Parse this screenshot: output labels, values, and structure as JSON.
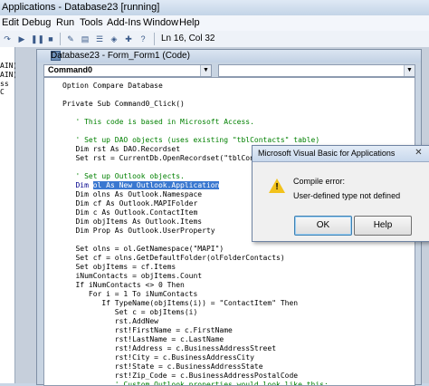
{
  "window": {
    "title": "Applications - Database23 [running]"
  },
  "menu": [
    "Edit",
    "Debug",
    "Run",
    "Tools",
    "Add-Ins",
    "Window",
    "Help"
  ],
  "toolbar": {
    "position": "Ln 16, Col 32"
  },
  "left_pane": [
    "AIN)",
    "AIN)",
    "ss C"
  ],
  "code_window": {
    "title": "Database23 - Form_Form1 (Code)",
    "object_combo": "Command0",
    "proc_combo": "",
    "lines": [
      "Option Compare Database",
      "",
      "Private Sub Command0_Click()",
      "",
      "   ' This code is based in Microsoft Access.",
      "",
      "   ' Set up DAO objects (uses existing \"tblContacts\" table)",
      "   Dim rst As DAO.Recordset",
      "   Set rst = CurrentDb.OpenRecordset(\"tblContacts\")",
      "",
      "   ' Set up Outlook objects.",
      "   Dim ol As New Outlook.Application",
      "   Dim olns As Outlook.Namespace",
      "   Dim cf As Outlook.MAPIFolder",
      "   Dim c As Outlook.ContactItem",
      "   Dim objItems As Outlook.Items",
      "   Dim Prop As Outlook.UserProperty",
      "",
      "   Set olns = ol.GetNamespace(\"MAPI\")",
      "   Set cf = olns.GetDefaultFolder(olFolderContacts)",
      "   Set objItems = cf.Items",
      "   iNumContacts = objItems.Count",
      "   If iNumContacts <> 0 Then",
      "      For i = 1 To iNumContacts",
      "         If TypeName(objItems(i)) = \"ContactItem\" Then",
      "            Set c = objItems(i)",
      "            rst.AddNew",
      "            rst!FirstName = c.FirstName",
      "            rst!LastName = c.LastName",
      "            rst!Address = c.BusinessAddressStreet",
      "            rst!City = c.BusinessAddressCity",
      "            rst!State = c.BusinessAddressState",
      "            rst!Zip_Code = c.BusinessAddressPostalCode",
      "            ' Custom Outlook properties would look like this:"
    ],
    "highlight": {
      "line": 11,
      "prefix": "   Dim ",
      "selected": "ol As New Outlook.Application",
      "suffix": ""
    }
  },
  "dialog": {
    "title": "Microsoft Visual Basic for Applications",
    "message1": "Compile error:",
    "message2": "User-defined type not defined",
    "ok": "OK",
    "help": "Help"
  },
  "colors": {
    "comment": "#008000",
    "keyword": "#00008b",
    "selection": "#3a78d0"
  }
}
